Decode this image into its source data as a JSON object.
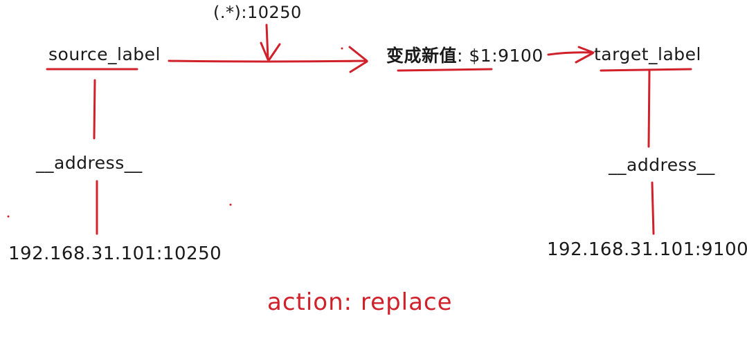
{
  "diagram": {
    "colors": {
      "ink": "#1a1a1a",
      "accent": "#d0202a"
    },
    "labels": {
      "regex": "(.*):10250",
      "source_label": "source_label",
      "new_value_prefix": "变成新值",
      "new_value_rest": ": $1:9100",
      "target_label": "target_label",
      "address_left": "__address__",
      "address_right": "__address__",
      "ip_left": "192.168.31.101:10250",
      "ip_right": "192.168.31.101:9100",
      "action": "action: replace"
    }
  }
}
